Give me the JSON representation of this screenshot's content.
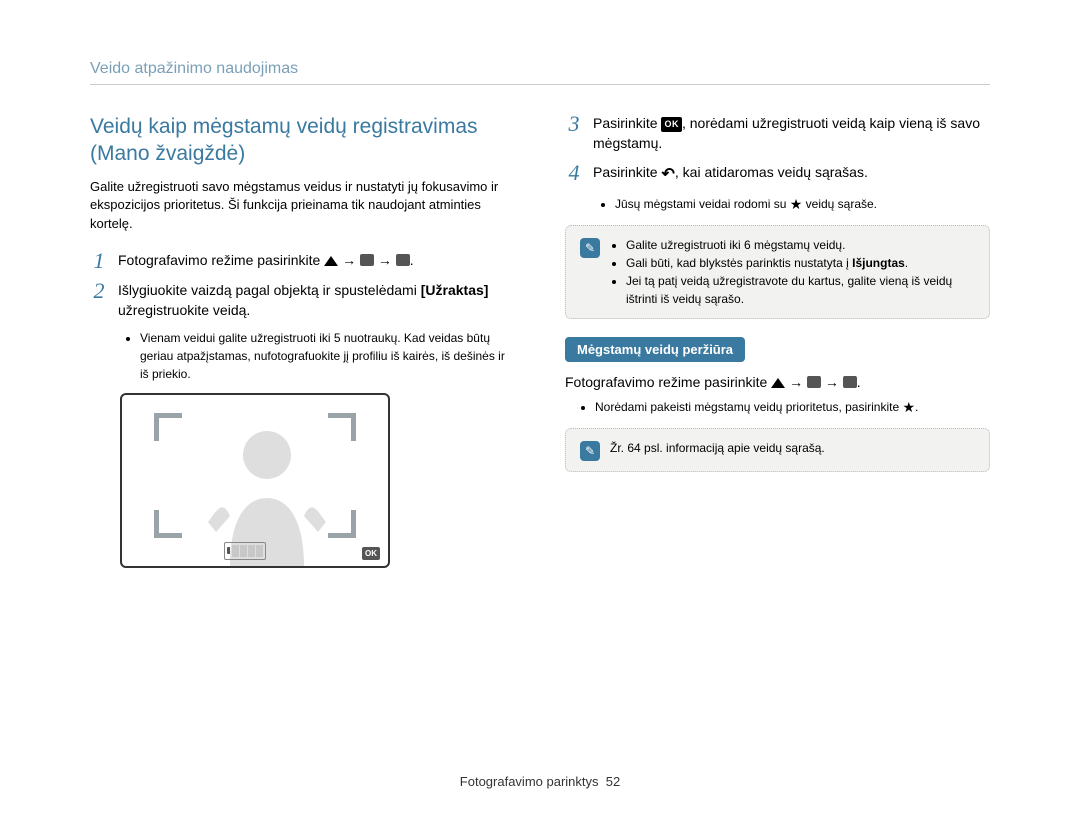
{
  "header": "Veido atpažinimo naudojimas",
  "left": {
    "title": "Veidų kaip mėgstamų veidų registravimas (Mano žvaigždė)",
    "intro": "Galite užregistruoti savo mėgstamus veidus ir nustatyti jų fokusavimo ir ekspozicijos prioritetus. Ši funkcija prieinama tik naudojant atminties kortelę.",
    "step1_prefix": "Fotografavimo režime pasirinkite ",
    "step2_a": "Išlygiuokite vaizdą pagal objektą ir spustelėdami ",
    "step2_bold": "[Užraktas]",
    "step2_b": " užregistruokite veidą.",
    "bullet1": "Vienam veidui galite užregistruoti iki 5 nuotraukų. Kad veidas būtų geriau atpažįstamas, nufotografuokite jį profiliu iš kairės, iš dešinės ir iš priekio."
  },
  "right": {
    "step3_a": "Pasirinkite ",
    "step3_b": ", norėdami užregistruoti veidą kaip vieną iš savo mėgstamų.",
    "step4_a": "Pasirinkite ",
    "step4_b": ", kai atidaromas veidų sąrašas.",
    "step4_bullet_a": "Jūsų mėgstami veidai rodomi su ",
    "step4_bullet_b": " veidų sąraše.",
    "note1_items": [
      "Galite užregistruoti iki 6 mėgstamų veidų.",
      "Gali būti, kad blykstės parinktis nustatyta į Išjungtas.",
      "Jei tą patį veidą užregistravote du kartus, galite vieną iš veidų ištrinti iš veidų sąrašo."
    ],
    "note1_bold": "Išjungtas",
    "subheading": "Mėgstamų veidų peržiūra",
    "review_prefix": "Fotografavimo režime pasirinkite ",
    "review_bullet": "Norėdami pakeisti mėgstamų veidų prioritetus, pasirinkite ",
    "note2": "Žr. 64 psl. informaciją apie veidų sąrašą."
  },
  "footer": {
    "label": "Fotografavimo parinktys",
    "page": "52"
  },
  "glyphs": {
    "ok": "OK",
    "arrow": "→",
    "back": "↶",
    "star": "★",
    "note": "✎"
  }
}
